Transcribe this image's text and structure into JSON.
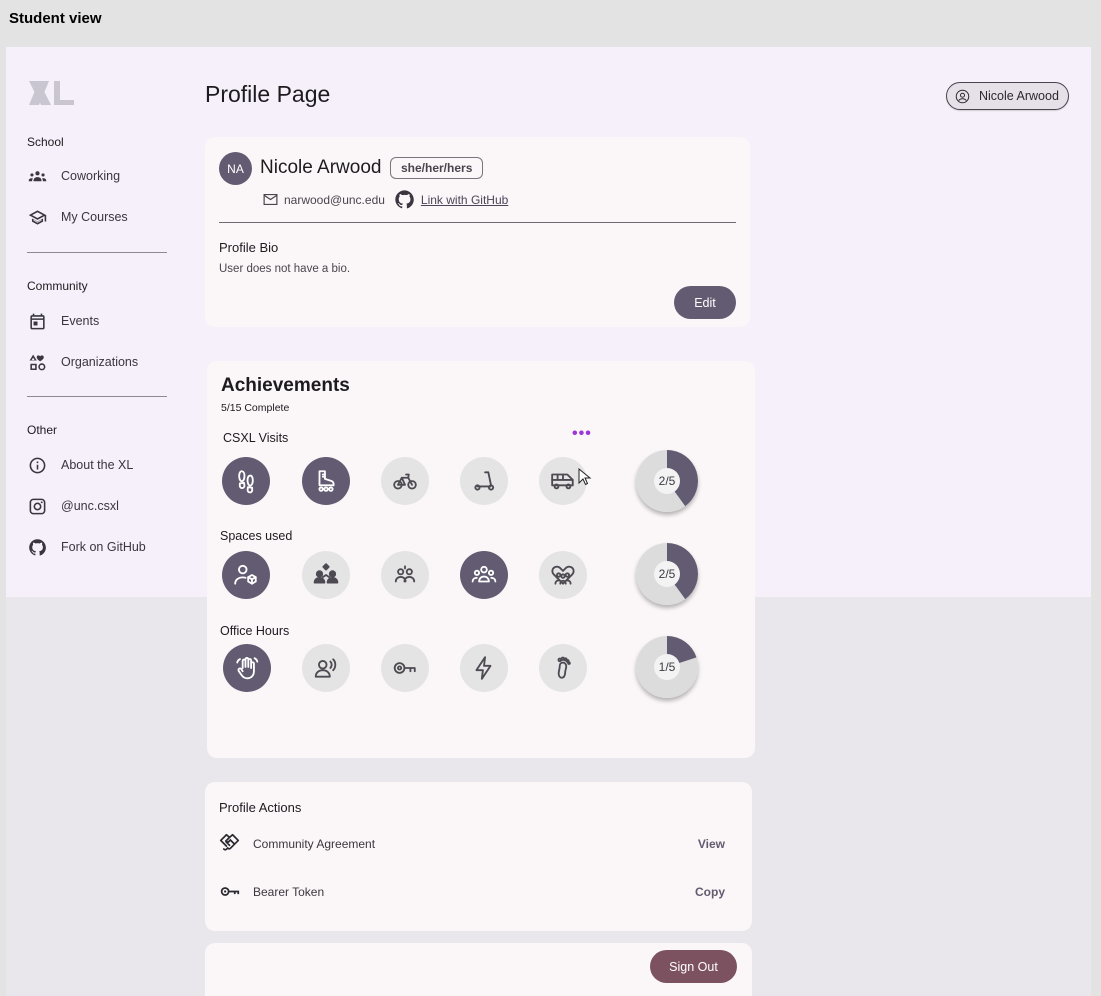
{
  "frame_title": "Student view",
  "sidebar": {
    "sections": [
      {
        "title": "School",
        "items": [
          {
            "label": "Coworking",
            "icon": "coworking-icon"
          },
          {
            "label": "My Courses",
            "icon": "school-icon"
          }
        ]
      },
      {
        "title": "Community",
        "items": [
          {
            "label": "Events",
            "icon": "calendar-icon"
          },
          {
            "label": "Organizations",
            "icon": "category-icon"
          }
        ]
      },
      {
        "title": "Other",
        "items": [
          {
            "label": "About the XL",
            "icon": "info-icon"
          },
          {
            "label": "@unc.csxl",
            "icon": "instagram-icon"
          },
          {
            "label": "Fork on GitHub",
            "icon": "github-icon"
          }
        ]
      }
    ]
  },
  "header": {
    "title": "Profile Page",
    "user_chip": "Nicole Arwood"
  },
  "profile": {
    "initials": "NA",
    "name": "Nicole Arwood",
    "pronouns": "she/her/hers",
    "email": "narwood@unc.edu",
    "github_link": "Link with GitHub",
    "bio_title": "Profile Bio",
    "bio_text": "User does not have a bio.",
    "edit_label": "Edit"
  },
  "achievements": {
    "title": "Achievements",
    "summary": "5/15 Complete",
    "more_indicator": "•••",
    "rows": [
      {
        "label": "CSXL Visits",
        "progress_label": "2/5",
        "progress": 0.4,
        "badges": [
          {
            "icon": "footsteps-icon",
            "earned": true
          },
          {
            "icon": "roller-skate-icon",
            "earned": true
          },
          {
            "icon": "bike-icon",
            "earned": false
          },
          {
            "icon": "scooter-icon",
            "earned": false
          },
          {
            "icon": "van-icon",
            "earned": false
          }
        ]
      },
      {
        "label": "Spaces used",
        "progress_label": "2/5",
        "progress": 0.4,
        "badges": [
          {
            "icon": "person-box-icon",
            "earned": true
          },
          {
            "icon": "group-diamond-icon",
            "earned": false
          },
          {
            "icon": "group-two-icon",
            "earned": false
          },
          {
            "icon": "group-three-icon",
            "earned": true
          },
          {
            "icon": "group-heart-icon",
            "earned": false
          }
        ]
      },
      {
        "label": "Office Hours",
        "progress_label": "1/5",
        "progress": 0.2,
        "badges": [
          {
            "icon": "raised-hand-icon",
            "earned": true
          },
          {
            "icon": "voice-person-icon",
            "earned": false
          },
          {
            "icon": "key-icon",
            "earned": false
          },
          {
            "icon": "bolt-icon",
            "earned": false
          },
          {
            "icon": "footprint-icon",
            "earned": false
          }
        ]
      }
    ]
  },
  "profile_actions": {
    "title": "Profile Actions",
    "items": [
      {
        "label": "Community Agreement",
        "action": "View",
        "icon": "handshake-icon"
      },
      {
        "label": "Bearer Token",
        "action": "Copy",
        "icon": "key-icon"
      }
    ]
  },
  "sign_out_label": "Sign Out",
  "colors": {
    "primary": "#625b71",
    "tertiary": "#7d5260",
    "surface": "#fbf7f8",
    "accent_dots": "#9c36d6"
  }
}
